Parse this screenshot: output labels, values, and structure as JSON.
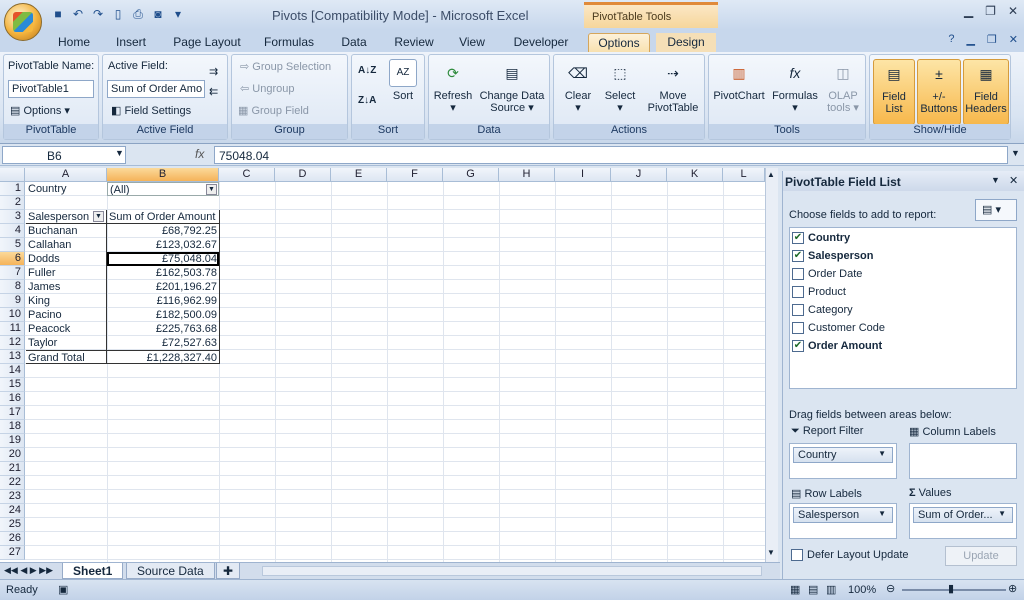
{
  "window": {
    "title": "Pivots  [Compatibility Mode] - Microsoft Excel",
    "context_tab_group": "PivotTable Tools"
  },
  "tabs": [
    "Home",
    "Insert",
    "Page Layout",
    "Formulas",
    "Data",
    "Review",
    "View",
    "Developer",
    "Options",
    "Design"
  ],
  "active_tab": "Options",
  "ribbon": {
    "pivottable": {
      "name_label": "PivotTable Name:",
      "name_value": "PivotTable1",
      "options_label": "Options",
      "group": "PivotTable"
    },
    "active_field": {
      "label": "Active Field:",
      "value": "Sum of Order Amo",
      "settings_label": "Field Settings",
      "group": "Active Field"
    },
    "group_grp": {
      "selection": "Group Selection",
      "ungroup": "Ungroup",
      "field": "Group Field",
      "group": "Group"
    },
    "sort": {
      "sort_label": "Sort",
      "group": "Sort"
    },
    "data": {
      "refresh": "Refresh",
      "change_source_1": "Change Data",
      "change_source_2": "Source",
      "group": "Data"
    },
    "actions": {
      "clear": "Clear",
      "select": "Select",
      "move_1": "Move",
      "move_2": "PivotTable",
      "group": "Actions"
    },
    "tools": {
      "pivotchart": "PivotChart",
      "formulas": "Formulas",
      "olap_1": "OLAP",
      "olap_2": "tools",
      "group": "Tools"
    },
    "showhide": {
      "fieldlist_1": "Field",
      "fieldlist_2": "List",
      "buttons_1": "+/-",
      "buttons_2": "Buttons",
      "headers_1": "Field",
      "headers_2": "Headers",
      "group": "Show/Hide"
    }
  },
  "formula_bar": {
    "name_box": "B6",
    "fx": "fx",
    "value": "75048.04"
  },
  "columns": [
    "A",
    "B",
    "C",
    "D",
    "E",
    "F",
    "G",
    "H",
    "I",
    "J",
    "K",
    "L"
  ],
  "rows": [
    "1",
    "2",
    "3",
    "4",
    "5",
    "6",
    "7",
    "8",
    "9",
    "10",
    "11",
    "12",
    "13",
    "14",
    "15",
    "16",
    "17",
    "18",
    "19",
    "20",
    "21",
    "22",
    "23",
    "24",
    "25",
    "26",
    "27"
  ],
  "pivot": {
    "filter_label": "Country",
    "filter_value": "(All)",
    "row_header": "Salesperson",
    "value_header": "Sum of Order Amount",
    "rows": [
      {
        "name": "Buchanan",
        "value": "£68,792.25"
      },
      {
        "name": "Callahan",
        "value": "£123,032.67"
      },
      {
        "name": "Dodds",
        "value": "£75,048.04"
      },
      {
        "name": "Fuller",
        "value": "£162,503.78"
      },
      {
        "name": "James",
        "value": "£201,196.27"
      },
      {
        "name": "King",
        "value": "£116,962.99"
      },
      {
        "name": "Pacino",
        "value": "£182,500.09"
      },
      {
        "name": "Peacock",
        "value": "£225,763.68"
      },
      {
        "name": "Taylor",
        "value": "£72,527.63"
      }
    ],
    "total_label": "Grand Total",
    "total_value": "£1,228,327.40"
  },
  "sheet_tabs": [
    "Sheet1",
    "Source Data"
  ],
  "status": {
    "ready": "Ready",
    "zoom": "100%"
  },
  "field_list": {
    "title": "PivotTable Field List",
    "choose_label": "Choose fields to add to report:",
    "fields": [
      {
        "name": "Country",
        "checked": true
      },
      {
        "name": "Salesperson",
        "checked": true
      },
      {
        "name": "Order Date",
        "checked": false
      },
      {
        "name": "Product",
        "checked": false
      },
      {
        "name": "Category",
        "checked": false
      },
      {
        "name": "Customer Code",
        "checked": false
      },
      {
        "name": "Order Amount",
        "checked": true
      }
    ],
    "drag_label": "Drag fields between areas below:",
    "report_filter": "Report Filter",
    "column_labels": "Column Labels",
    "row_labels": "Row Labels",
    "values": "Values",
    "filter_chip": "Country",
    "row_chip": "Salesperson",
    "value_chip": "Sum of Order...",
    "defer_label": "Defer Layout Update",
    "update_label": "Update"
  }
}
